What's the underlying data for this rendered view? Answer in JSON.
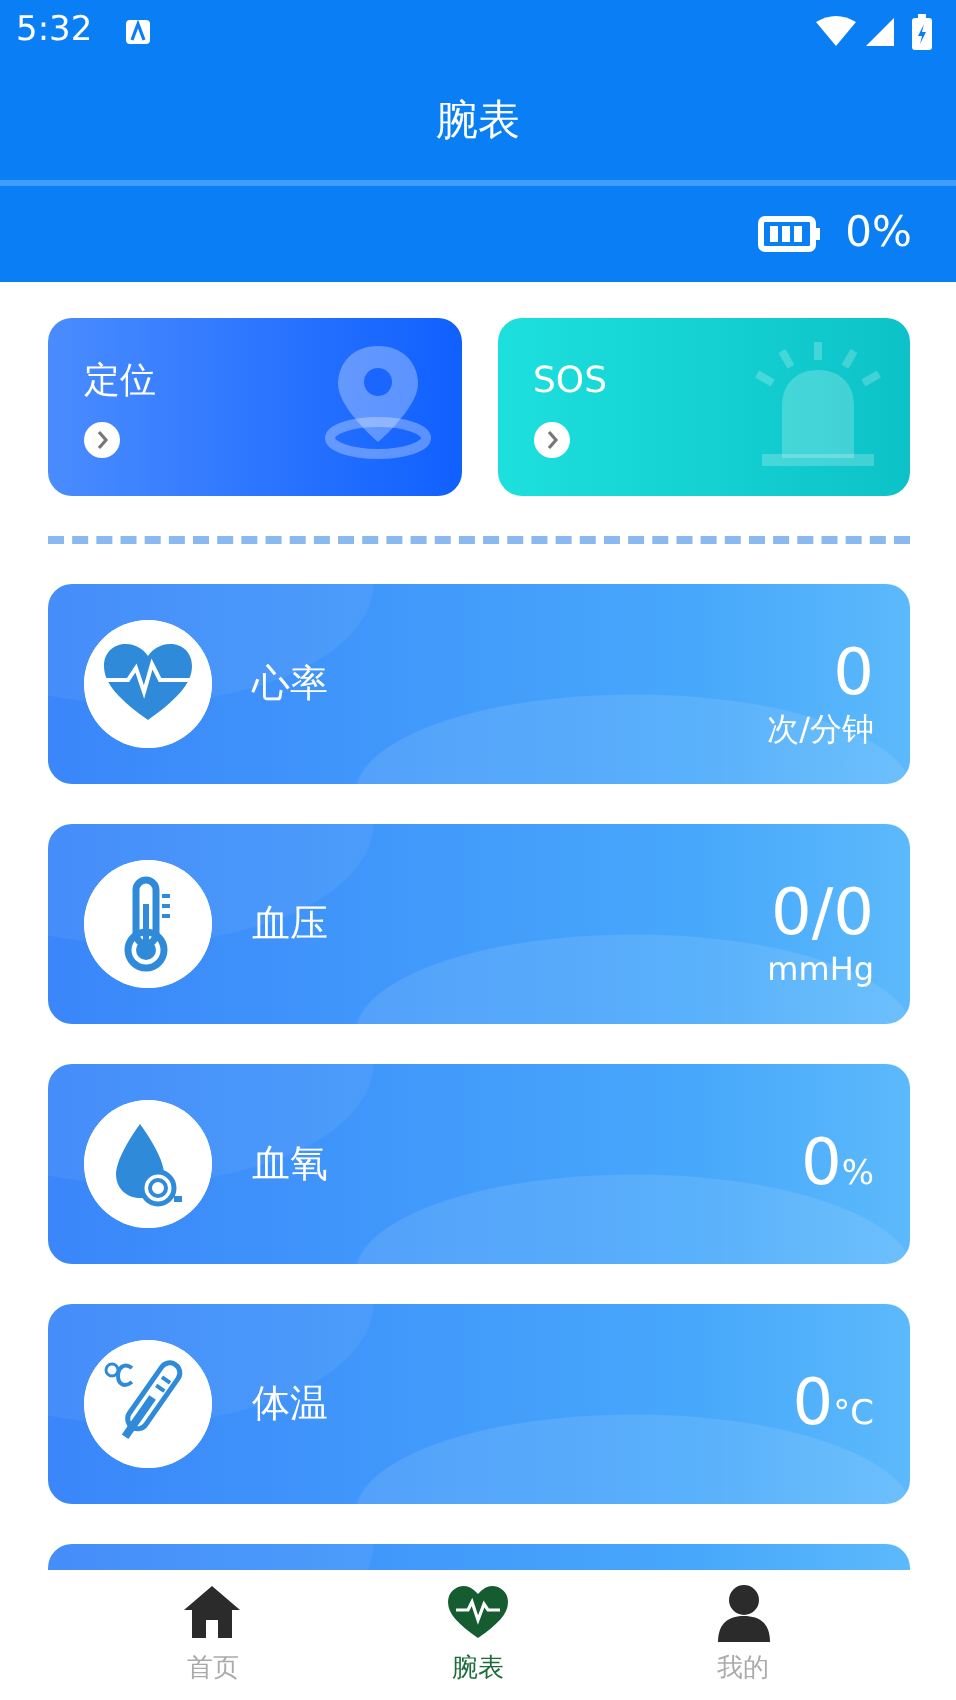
{
  "status_bar": {
    "time": "5:32"
  },
  "title": "腕表",
  "battery": {
    "reading": "0%"
  },
  "shortcuts": [
    {
      "label": "定位",
      "kind": "location"
    },
    {
      "label": "SOS",
      "kind": "sos"
    }
  ],
  "metrics": [
    {
      "kind": "heart",
      "label": "心率",
      "value": "0",
      "unit": "次/分钟"
    },
    {
      "kind": "pressure",
      "label": "血压",
      "value": "0/0",
      "unit": "mmHg"
    },
    {
      "kind": "oxygen",
      "label": "血氧",
      "value": "0",
      "unit": "%"
    },
    {
      "kind": "temperature",
      "label": "体温",
      "value": "0",
      "unit": "°C"
    },
    {
      "kind": "cut-off"
    }
  ],
  "tabs": [
    {
      "label": "首页",
      "kind": "home",
      "selected": false
    },
    {
      "label": "腕表",
      "kind": "heart",
      "selected": true
    },
    {
      "label": "我的",
      "kind": "person",
      "selected": false
    }
  ]
}
